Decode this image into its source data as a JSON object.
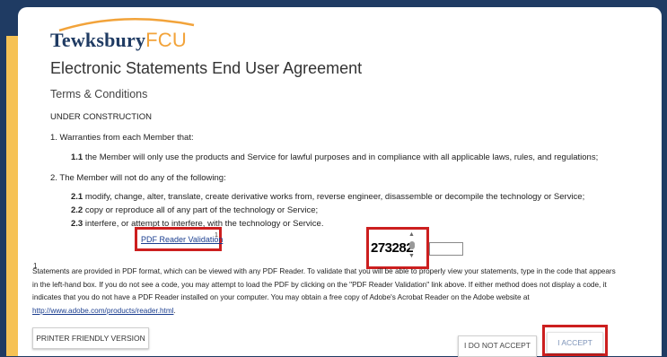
{
  "logo": {
    "name_main": "Tewksbury",
    "name_accent": "FCU"
  },
  "page": {
    "title": "Electronic Statements End User Agreement",
    "subtitle": "Terms & Conditions",
    "status": "UNDER CONSTRUCTION"
  },
  "sections": {
    "s1_heading": "1. Warranties from each Member that:",
    "s1_1_num": "1.1",
    "s1_1_text": " the Member will only use the products and Service for lawful purposes and in compliance with all applicable laws, rules, and regulations;",
    "s2_heading": "2. The Member will not do any of the following:",
    "s2_1_num": "2.1",
    "s2_1_text": " modify, change, alter, translate, create derivative works from, reverse engineer, disassemble or decompile the technology or Service;",
    "s2_2_num": "2.2",
    "s2_2_text": " copy or reproduce all of any part of the technology or Service;",
    "s2_3_num": "2.3",
    "s2_3_text": " interfere, or attempt to interfere, with the technology or Service."
  },
  "validation": {
    "pdf_link": "PDF Reader Validation",
    "pdf_sup": "1",
    "code": "273282",
    "code_input_value": ""
  },
  "footnote": {
    "sup": "1",
    "text": " Statements are provided in PDF format, which can be viewed with any PDF Reader. To validate that you will be able to properly view your statements, type in the code that appears in the left-hand box. If you do not see a code, you may attempt to load the PDF by clicking on the \"PDF Reader Validation\" link above. If either method does not display a code, it indicates that you do not have a PDF Reader installed on your computer. You may obtain a free copy of Adobe's Acrobat Reader on the Adobe website at ",
    "link": "http://www.adobe.com/products/reader.html",
    "end": "."
  },
  "buttons": {
    "print": "PRINTER FRIENDLY VERSION",
    "decline": "I DO NOT ACCEPT",
    "accept": "I ACCEPT"
  },
  "colors": {
    "frame": "#1f3b63",
    "accent": "#f6c255",
    "highlight": "#cc1f1f",
    "logo_orange": "#f2a33a"
  }
}
